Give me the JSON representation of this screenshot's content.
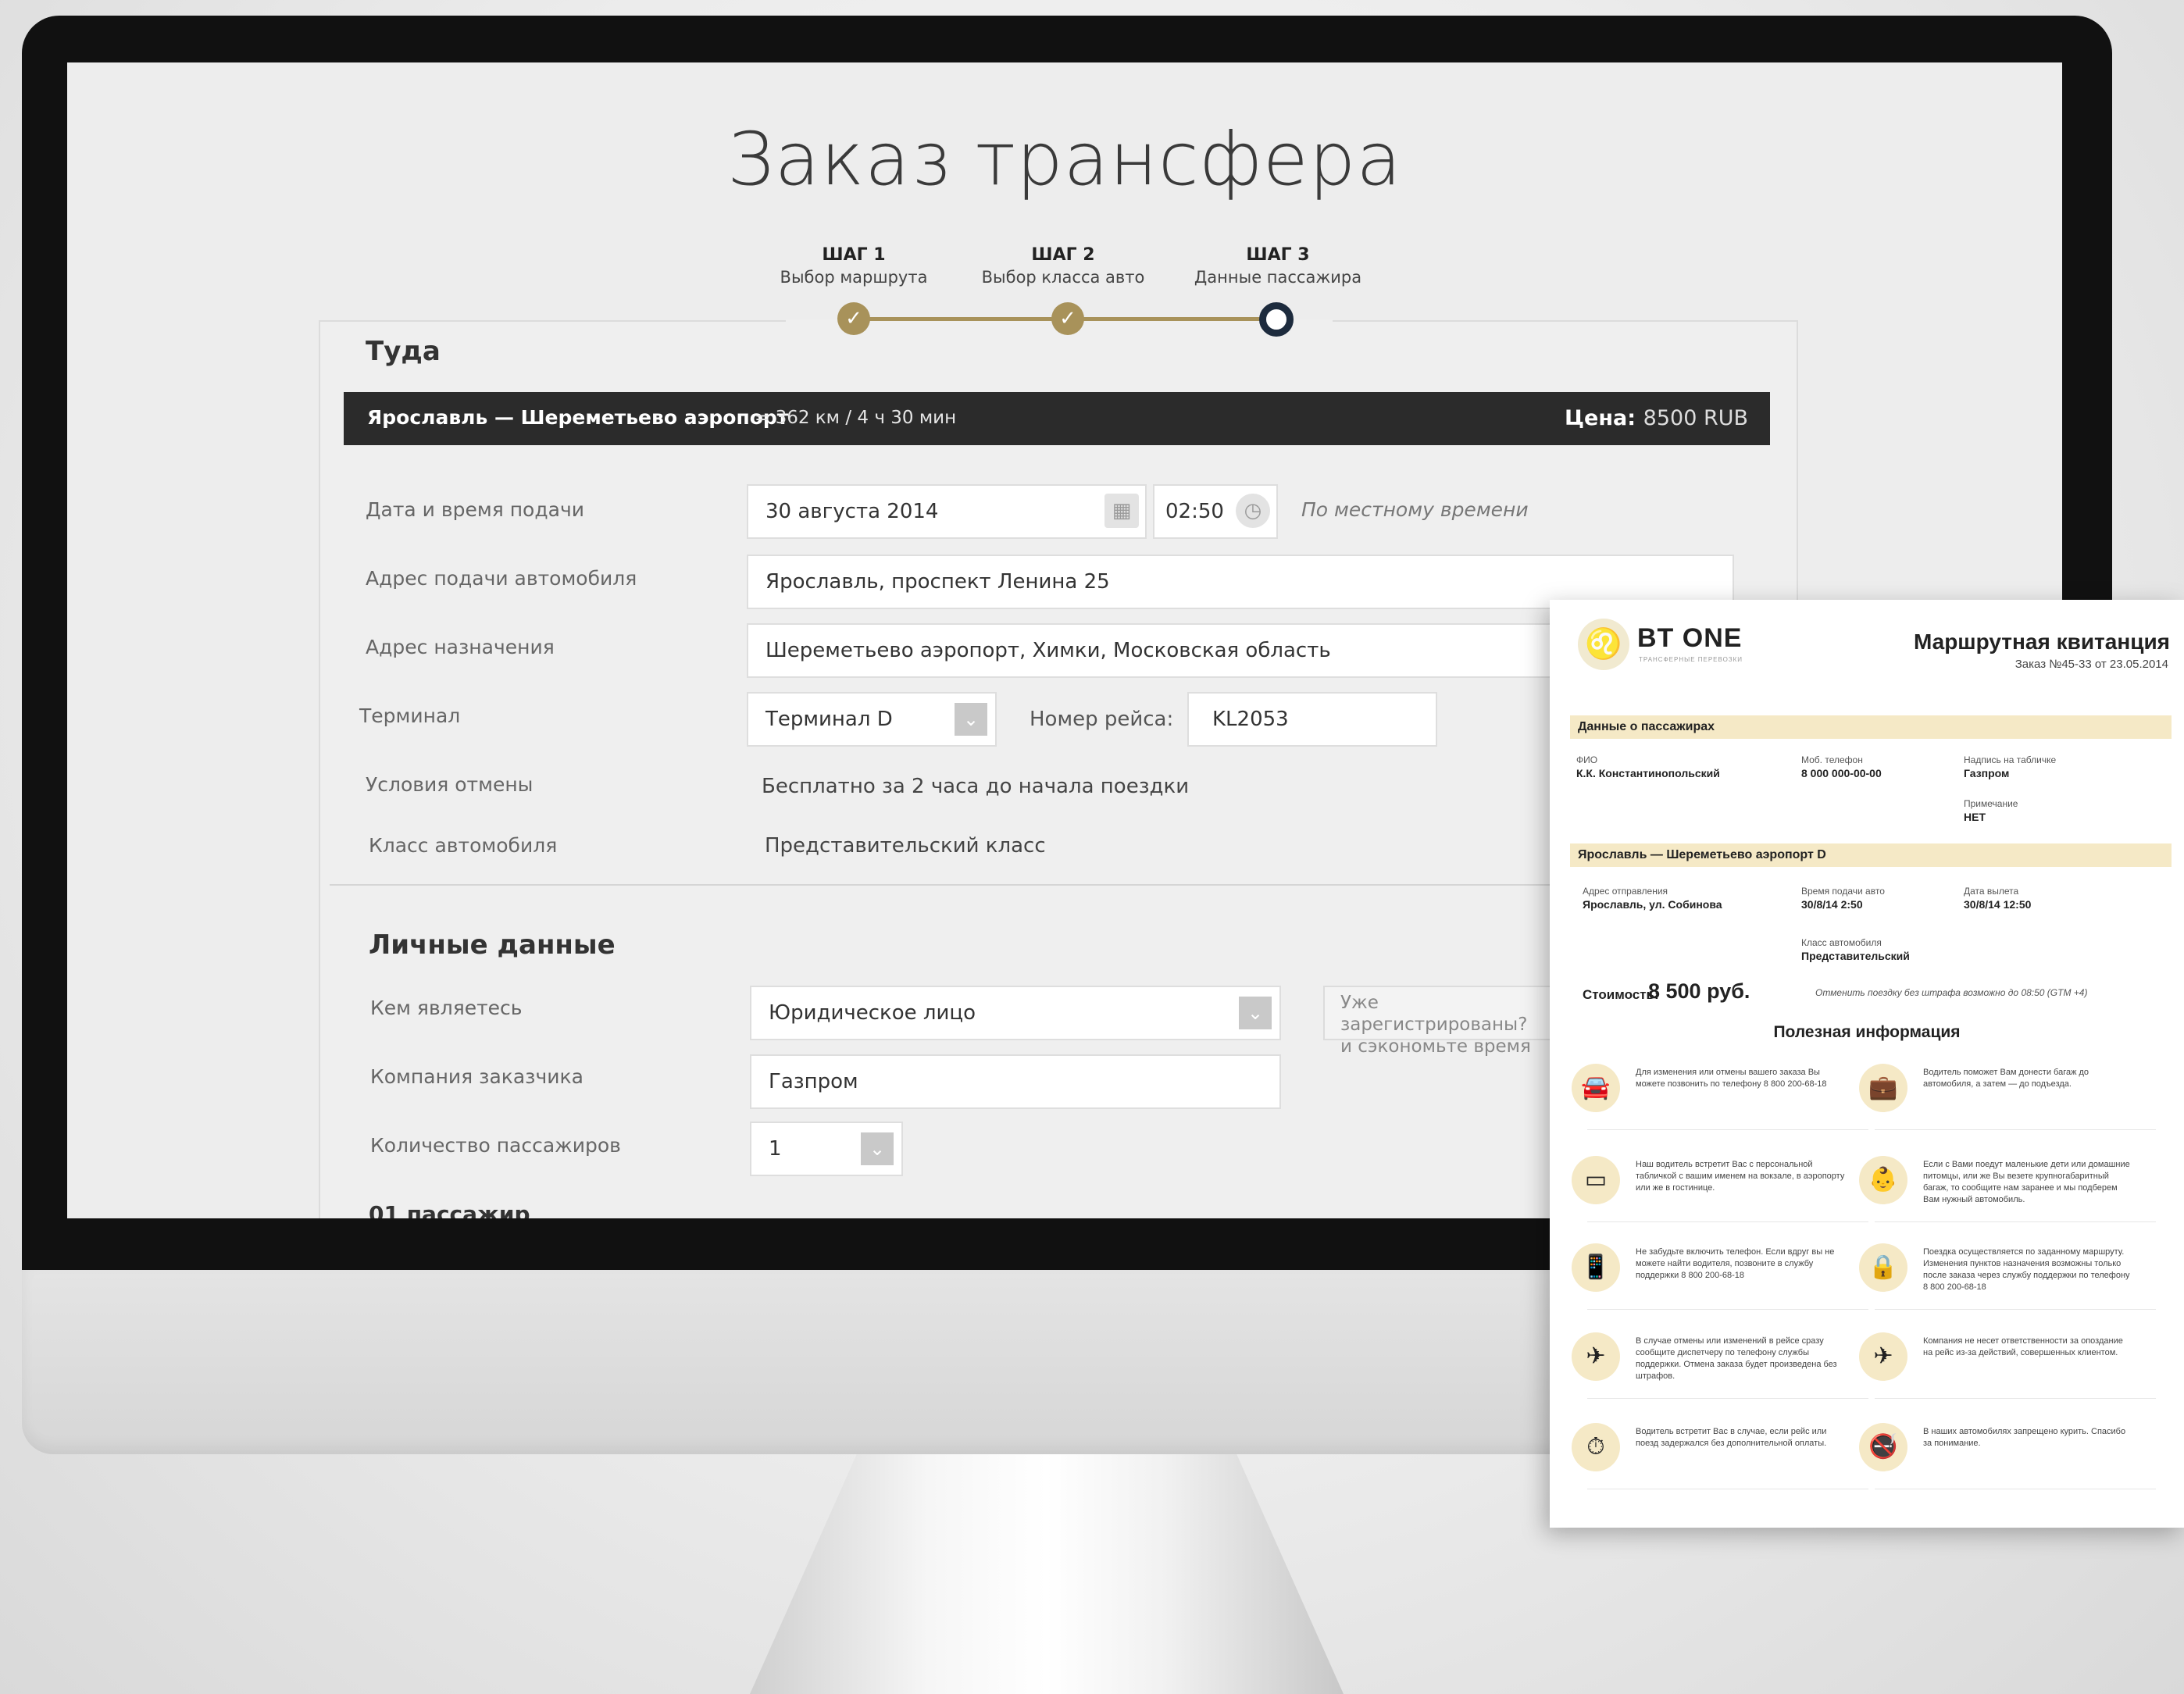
{
  "page": {
    "title": "Заказ трансфера"
  },
  "steps": [
    {
      "num": "ШАГ 1",
      "label": "Выбор маршрута",
      "state": "done"
    },
    {
      "num": "ШАГ 2",
      "label": "Выбор класса авто",
      "state": "done"
    },
    {
      "num": "ШАГ 3",
      "label": "Данные пассажира",
      "state": "current"
    }
  ],
  "trip": {
    "section_title": "Туда",
    "route": "Ярославль — Шереметьево аэропорт",
    "distance": "= 362 км / 4 ч 30 мин",
    "price_label": "Цена:",
    "price_value": "8500 RUB"
  },
  "form": {
    "date_label": "Дата и время подачи",
    "date_value": "30 августа 2014",
    "time_value": "02:50",
    "time_hint": "По местному времени",
    "pickup_label": "Адрес подачи автомобиля",
    "pickup_value": "Ярославль, проспект Ленина 25",
    "dest_label": "Адрес назначения",
    "dest_value": "Шереметьево аэропорт,  Химки, Московская область",
    "terminal_label": "Терминал",
    "terminal_value": "Терминал D",
    "flight_label": "Номер рейса:",
    "flight_value": "KL2053",
    "cancel_label": "Условия отмены",
    "cancel_value": "Бесплатно за  2 часа  до начала поездки",
    "class_label": "Класс автомобиля",
    "class_value": "Представительский класс"
  },
  "personal": {
    "section_title": "Личные данные",
    "who_label": "Кем являетесь",
    "who_value": "Юридическое лицо",
    "reg_hint_line1": "Уже зарегистрированы?",
    "reg_hint_line2": "и сэкономьте время",
    "company_label": "Компания заказчика",
    "company_value": "Газпром",
    "passengers_label": "Количество пассажиров",
    "passengers_value": "1",
    "passenger_heading": "01 пассажир"
  },
  "receipt": {
    "logo_text": "BT ONE",
    "logo_sub": "ТРАНСФЕРНЫЕ ПЕРЕВОЗКИ",
    "title": "Маршрутная квитанция",
    "order": "Заказ №45-33 от 23.05.2014",
    "passengers_band": "Данные о пассажирах",
    "fio_label": "ФИО",
    "fio_value": "К.К. Константинопольский",
    "phone_label": "Моб. телефон",
    "phone_value": "8 000 000-00-00",
    "sign_label": "Надпись на табличке",
    "sign_value": "Газпром",
    "note_label": "Примечание",
    "note_value": "НЕТ",
    "route_band": "Ярославль — Шереметьево аэропорт D",
    "depart_label": "Адрес отправления",
    "depart_value": "Ярославль, ул. Собинова",
    "pickup_time_label": "Время подачи авто",
    "pickup_time_value": "30/8/14 2:50",
    "flight_date_label": "Дата вылета",
    "flight_date_value": "30/8/14 12:50",
    "car_class_label": "Класс автомобиля",
    "car_class_value": "Представительский",
    "cost_label": "Стоимость:",
    "cost_value": "8 500 руб.",
    "cost_note": "Отменить поездку без штрафа возможно до 08:50 (GTM +4)",
    "info_title": "Полезная информация",
    "info_items": [
      {
        "icon": "car-icon",
        "glyph": "🚘",
        "text": "Для изменения или отмены вашего заказа Вы можете позвонить по телефону 8 800 200-68-18"
      },
      {
        "icon": "luggage-icon",
        "glyph": "💼",
        "text": "Водитель поможет Вам донести багаж до автомобиля, а затем — до подъезда."
      },
      {
        "icon": "sign-icon",
        "glyph": "▭",
        "text": "Наш водитель встретит Вас с персональной табличкой с вашим именем на вокзале, в аэропорту или же в гостинице."
      },
      {
        "icon": "child-icon",
        "glyph": "👶",
        "text": "Если с Вами поедут маленькие дети или домашние питомцы, или же Вы везете крупногабаритный багаж, то сообщите нам заранее и мы подберем Вам нужный автомобиль."
      },
      {
        "icon": "phone-icon",
        "glyph": "📱",
        "text": "Не забудьте включить телефон. Если вдруг вы не можете найти водителя, позвоните в службу поддержки 8 800 200-68-18"
      },
      {
        "icon": "lock-icon",
        "glyph": "🔒",
        "text": "Поездка осуществляется по заданному маршруту. Изменения пунктов назначения возможны только после заказа через службу поддержки по телефону 8 800 200-68-18"
      },
      {
        "icon": "flight-cancel-icon",
        "glyph": "✈",
        "text": "В случае отмены или изменений в рейсе сразу сообщите диспетчеру по телефону службы поддержки. Отмена заказа будет произведена без штрафов."
      },
      {
        "icon": "plane-icon",
        "glyph": "✈",
        "text": "Компания не несет ответственности за опоздание на рейс из-за действий, совершенных клиентом."
      },
      {
        "icon": "stopwatch-icon",
        "glyph": "⏱",
        "text": "Водитель встретит Вас в случае, если рейс или поезд задержался без дополнительной оплаты."
      },
      {
        "icon": "no-smoking-icon",
        "glyph": "🚭",
        "text": "В наших автомобилях запрещено курить. Спасибо за понимание."
      }
    ]
  },
  "colors": {
    "accent_gold": "#a8925a",
    "step_current": "#1d2b3d",
    "route_bar": "#2b2b2b",
    "receipt_band": "#f5e9c6"
  }
}
